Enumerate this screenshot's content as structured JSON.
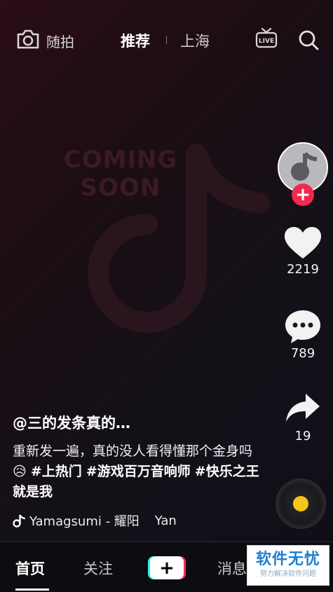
{
  "app": {
    "name": "抖音"
  },
  "background": {
    "watermark_text_line1": "COMING",
    "watermark_text_line2": "SOON"
  },
  "topbar": {
    "camera_label": "随拍",
    "tabs": [
      {
        "label": "推荐",
        "active": true
      },
      {
        "label": "上海",
        "active": false
      }
    ],
    "live_icon": "live-tv-icon",
    "search_icon": "search-icon"
  },
  "rail": {
    "follow_symbol": "+",
    "likes": "2219",
    "comments": "789",
    "shares": "19"
  },
  "caption": {
    "author": "@三的发条真的…",
    "desc_text1": "重新发一遍，真的没人看得懂那个金身吗",
    "emoji": "😥",
    "tags": [
      "#上热门",
      "#游戏百万音响师",
      "#快乐之王就是我"
    ]
  },
  "music": {
    "text": "Yamagsumi - 耀阳",
    "text_repeat": "Yan"
  },
  "bottom_nav": {
    "items": [
      {
        "label": "首页",
        "active": true
      },
      {
        "label": "关注",
        "active": false
      },
      {
        "label": "消息",
        "active": false
      }
    ],
    "create_symbol": "+"
  },
  "watermark": {
    "title": "软件无忧",
    "subtitle": "努力解决软件问题"
  },
  "colors": {
    "accent": "#f2294f",
    "tiktok_cyan": "#25f4ee",
    "tiktok_red": "#fe2c55",
    "disc_center": "#f5c518"
  }
}
